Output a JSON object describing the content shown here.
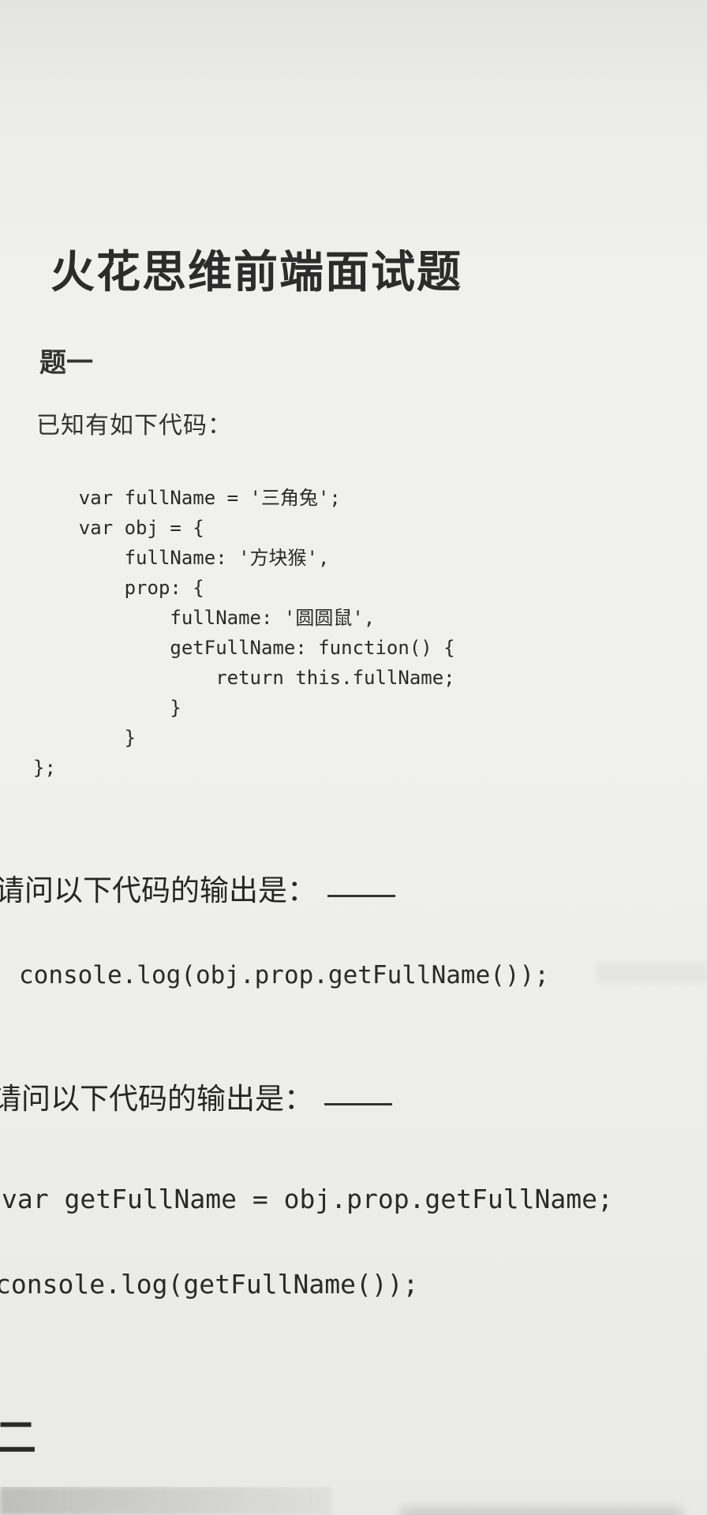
{
  "document": {
    "title": "火花思维前端面试题",
    "section_one": "题一",
    "intro": "已知有如下代码：",
    "code_lines": [
      "    var fullName = '三角兔';",
      "    var obj = {",
      "        fullName: '方块猴',",
      "        prop: {",
      "            fullName: '圆圆鼠',",
      "            getFullName: function() {",
      "                return this.fullName;",
      "            }",
      "        }",
      "};"
    ],
    "question_one": "请问以下代码的输出是：",
    "code_one": "console.log(obj.prop.getFullName());",
    "question_two": "请问以下代码的输出是：",
    "code_two": "var getFullName = obj.prop.getFullName;",
    "code_three": "console.log(getFullName());",
    "section_two": "二"
  }
}
